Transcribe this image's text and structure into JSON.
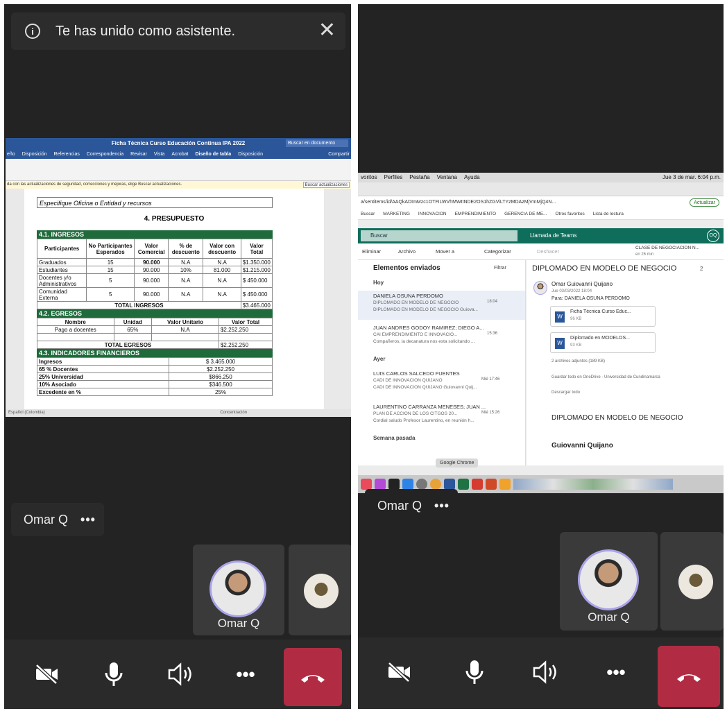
{
  "left": {
    "banner": "Te has unido como asistente.",
    "presenter_name": "Omar Q",
    "more": "•••",
    "tile_name": "Omar Q",
    "doc": {
      "title": "Ficha Técnica Curso Educación Continua IPA 2022",
      "search": "Buscar en documento",
      "tabs": [
        "eño",
        "Disposición",
        "Referencias",
        "Correspondencia",
        "Revisar",
        "Vista",
        "Acrobat",
        "Diseño de tabla",
        "Disposición"
      ],
      "share": "Compartir",
      "update_msg": "da con las actualizaciones de seguridad, correcciones y mejoras, elige Buscar actualizaciones.",
      "update_btn": "Buscar actualizaciones",
      "specify": "Especifique Oficina o Entidad y recursos",
      "heading": "4. PRESUPUESTO",
      "s1": "4.1. INGRESOS",
      "s1_headers": [
        "Participantes",
        "No Participantes Esperados",
        "Valor Comercial",
        "% de descuento",
        "Valor con descuento",
        "Valor Total"
      ],
      "s1_rows": [
        [
          "Graduados",
          "15",
          "90.000",
          "N.A",
          "N.A",
          "$1.350.000"
        ],
        [
          "Estudiantes",
          "15",
          "90.000",
          "10%",
          "81.000",
          "$1.215.000"
        ],
        [
          "Docentes y/o Administrativos",
          "5",
          "90.000",
          "N.A",
          "N.A",
          "$ 450.000"
        ],
        [
          "Comunidad Externa",
          "5",
          "90.000",
          "N.A",
          "N.A",
          "$ 450.000"
        ]
      ],
      "s1_total_label": "TOTAL INGRESOS",
      "s1_total": "$3.465.000",
      "s2": "4.2. EGRESOS",
      "s2_headers": [
        "Nombre",
        "Unidad",
        "Valor Unitario",
        "Valor Total"
      ],
      "s2_row": [
        "Pago a docentes",
        "65%",
        "N.A",
        "$2.252.250"
      ],
      "s2_total_label": "TOTAL EGRESOS",
      "s2_total": "$2.252.250",
      "s3": "4.3. INDICADORES FINANCIEROS",
      "s3_rows": [
        [
          "Ingresos",
          "$ 3.465.000"
        ],
        [
          "65 % Docentes",
          "$2.252.250"
        ],
        [
          "25% Universidad",
          "$866.250"
        ],
        [
          "10% Asociado",
          "$346.500"
        ],
        [
          "Excedente en %",
          "25%"
        ]
      ],
      "status_lang": "Español (Colombia)",
      "status_focus": "Concentración"
    }
  },
  "right": {
    "presenter_name": "Omar Q",
    "more": "•••",
    "tile_name": "Omar Q",
    "mac_menu": [
      "voritos",
      "Perfiles",
      "Pestaña",
      "Ventana",
      "Ayuda"
    ],
    "clock": "Jue 3 de mar. 6:04 p.m.",
    "url": "a/sentitems/id/AAQkADImMzc1OTFILWVhMWItNDE2OS1hZGViLTYzMDAzMjVmMjQ4N...",
    "update_btn": "Actualizar",
    "bookmarks": [
      "Buscar",
      "MARKETING",
      "INNOVACION",
      "EMPRENDIMIENTO",
      "GERENCIA DE ME...",
      "Otros favoritos",
      "Lista de lectura"
    ],
    "search": "Buscar",
    "teams_call": "Llamada de Teams",
    "toolbar": [
      "Eliminar",
      "Archivo",
      "Mover a",
      "Categorizar",
      "Deshacer"
    ],
    "reminder": "CLASE DE NEGOCIACION N...",
    "reminder_sub": "en 26 min",
    "folder": "Elementos enviados",
    "filter": "Filtrar",
    "groups": {
      "today": "Hoy",
      "yesterday": "Ayer",
      "lastweek": "Semana pasada"
    },
    "mails": [
      {
        "from": "DANIELA OSUNA PERDOMO",
        "subject": "DIPLOMADO EN MODELO DE NEGOCIO",
        "time": "18:04",
        "preview": "DIPLOMADO EN MODELO DE NEGOCIO Guiova..."
      },
      {
        "from": "JUAN ANDRES GODOY RAMIREZ; DIEGO A...",
        "subject": "CAI EMPRENDIMIENTO E INNOVACIÓ...",
        "time": "15:36",
        "preview": "Compañeros, la decanatura nos esta solicitando ..."
      },
      {
        "from": "LUIS CARLOS SALCEDO FUENTES",
        "subject": "CADI DE INNOVACION QUIJANO",
        "time": "Mié 17:46",
        "preview": "CADI DE INNOVACION QUIJANO Guiovanni Quij..."
      },
      {
        "from": "LAURENTINO CARRANZA MENESES; JUAN ...",
        "subject": "PLAN DE ACCION DE LOS CITGOS 20...",
        "time": "Mié 15:26",
        "preview": "Cordial saludo Profesor Laurentino, en reunión h..."
      }
    ],
    "reading_title": "DIPLOMADO EN MODELO DE NEGOCIO",
    "reading_count": "2",
    "sender": "Omar Guiovanni Quijano",
    "sent_date": "Jue 03/03/2022 18:04",
    "to": "Para:  DANIELA OSUNA PERDOMO",
    "attachments": [
      {
        "name": "Ficha Técnica Curso Educ...",
        "size": "96 KB"
      },
      {
        "name": "Diplomado en MODELOS...",
        "size": "93 KB"
      }
    ],
    "attach_count": "2 archivos adjuntos (189 KB)",
    "save_onedrive": "Guardar todo en OneDrive - Universidad de Cundinamarca",
    "download_all": "Descargar todo",
    "body_title": "DIPLOMADO EN MODELO DE NEGOCIO",
    "body_sign": "Guiovanni Quijano",
    "dock_tooltip": "Google Chrome"
  },
  "colors": {
    "panel": "#232323",
    "hangup": "#b12c43",
    "avatar_ring": "#a9a3e8",
    "excel_green": "#1f6b3c",
    "outlook_teal": "#0f6e5b"
  }
}
